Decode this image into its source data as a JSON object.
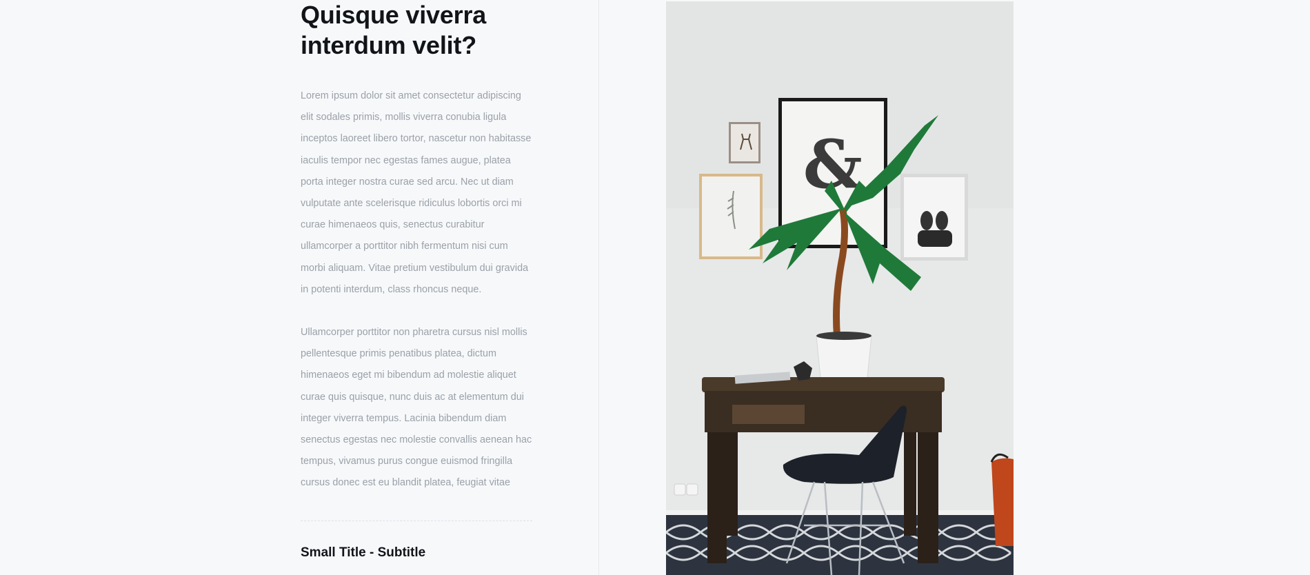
{
  "article": {
    "title_line1": "Quisque viverra",
    "title_line2": "interdum velit?",
    "paragraph1": "Lorem ipsum dolor sit amet consectetur adipiscing elit sodales primis, mollis viverra conubia ligula inceptos laoreet libero tortor, nascetur non habitasse iaculis tempor nec egestas fames augue, platea porta integer nostra curae sed arcu. Nec ut diam vulputate ante scelerisque ridiculus lobortis orci mi curae himenaeos quis, senectus curabitur ullamcorper a porttitor nibh fermentum nisi cum morbi aliquam. Vitae pretium vestibulum dui gravida in potenti interdum, class rhoncus neque.",
    "paragraph2": "Ullamcorper porttitor non pharetra cursus nisl mollis pellentesque primis penatibus platea, dictum himenaeos eget mi bibendum ad molestie aliquet curae quis quisque, nunc duis ac at elementum dui integer viverra tempus. Lacinia bibendum diam senectus egestas nec molestie convallis aenean hac tempus, vivamus purus congue euismod fringilla cursus donec est eu blandit platea, feugiat vitae",
    "small_title": "Small Title - Subtitle"
  },
  "photo": {
    "subject": "interior-desk-plant-photo",
    "poster_glyph": "&"
  },
  "colors": {
    "background": "#f7f8fa",
    "heading": "#111418",
    "body_text": "#9aa1a8"
  }
}
